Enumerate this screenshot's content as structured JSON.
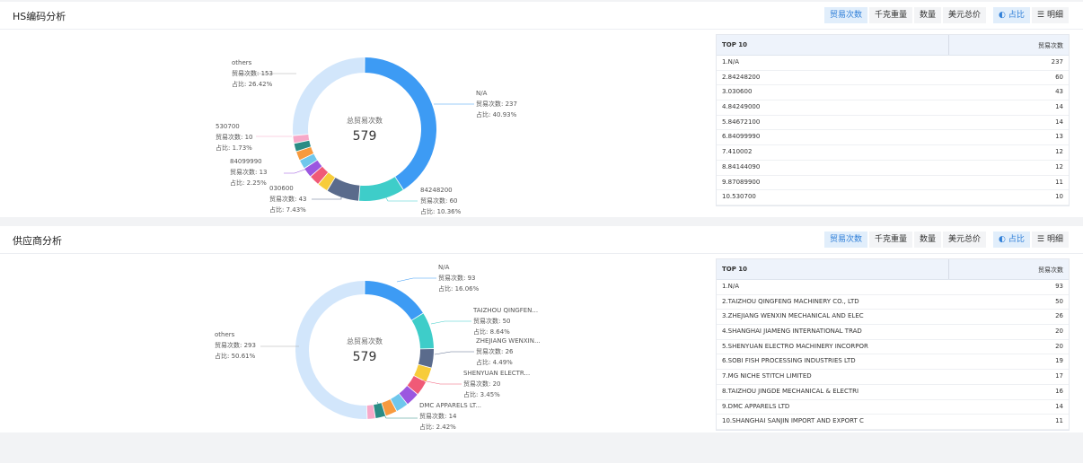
{
  "toolbar": {
    "buttons": [
      "贸易次数",
      "千克重量",
      "数量",
      "美元总价"
    ],
    "view_ratio": "占比",
    "view_detail": "明细"
  },
  "hs_panel": {
    "title": "HS编码分析",
    "center_label": "总贸易次数",
    "center_value": "579",
    "labels": {
      "others": {
        "name": "others",
        "count": "贸易次数: 153",
        "pct": "占比: 26.42%"
      },
      "na": {
        "name": "N/A",
        "count": "贸易次数: 237",
        "pct": "占比: 40.93%"
      },
      "s530700": {
        "name": "530700",
        "count": "贸易次数: 10",
        "pct": "占比: 1.73%"
      },
      "s84099990": {
        "name": "84099990",
        "count": "贸易次数: 13",
        "pct": "占比: 2.25%"
      },
      "s030600": {
        "name": "030600",
        "count": "贸易次数: 43",
        "pct": "占比: 7.43%"
      },
      "s84248200": {
        "name": "84248200",
        "count": "贸易次数: 60",
        "pct": "占比: 10.36%"
      }
    },
    "table": {
      "header_left": "TOP 10",
      "header_right": "贸易次数",
      "rows": [
        {
          "label": "1.N/A",
          "value": "237"
        },
        {
          "label": "2.84248200",
          "value": "60"
        },
        {
          "label": "3.030600",
          "value": "43"
        },
        {
          "label": "4.84249000",
          "value": "14"
        },
        {
          "label": "5.84672100",
          "value": "14"
        },
        {
          "label": "6.84099990",
          "value": "13"
        },
        {
          "label": "7.410002",
          "value": "12"
        },
        {
          "label": "8.84144090",
          "value": "12"
        },
        {
          "label": "9.87089900",
          "value": "11"
        },
        {
          "label": "10.530700",
          "value": "10"
        }
      ]
    }
  },
  "supplier_panel": {
    "title": "供应商分析",
    "center_label": "总贸易次数",
    "center_value": "579",
    "labels": {
      "na": {
        "name": "N/A",
        "count": "贸易次数: 93",
        "pct": "占比: 16.06%"
      },
      "taizhou": {
        "name": "TAIZHOU QINGFEN...",
        "count": "贸易次数: 50",
        "pct": "占比: 8.64%"
      },
      "zhejiang": {
        "name": "ZHEJIANG WENXIN...",
        "count": "贸易次数: 26",
        "pct": "占比: 4.49%"
      },
      "shenyuan": {
        "name": "SHENYUAN ELECTR...",
        "count": "贸易次数: 20",
        "pct": "占比: 3.45%"
      },
      "dmc": {
        "name": "DMC APPARELS LT...",
        "count": "贸易次数: 14",
        "pct": "占比: 2.42%"
      },
      "others": {
        "name": "others",
        "count": "贸易次数: 293",
        "pct": "占比: 50.61%"
      }
    },
    "table": {
      "header_left": "TOP 10",
      "header_right": "贸易次数",
      "rows": [
        {
          "label": "1.N/A",
          "value": "93"
        },
        {
          "label": "2.TAIZHOU QINGFENG MACHINERY CO., LTD",
          "value": "50"
        },
        {
          "label": "3.ZHEJIANG WENXIN MECHANICAL AND ELEC",
          "value": "26"
        },
        {
          "label": "4.SHANGHAI JIAMENG INTERNATIONAL TRAD",
          "value": "20"
        },
        {
          "label": "5.SHENYUAN ELECTRO MACHINERY INCORPOR",
          "value": "20"
        },
        {
          "label": "6.SOBI FISH PROCESSING INDUSTRIES LTD",
          "value": "19"
        },
        {
          "label": "7.MG NICHE STITCH LIMITED",
          "value": "17"
        },
        {
          "label": "8.TAIZHOU JINGDE MECHANICAL & ELECTRI",
          "value": "16"
        },
        {
          "label": "9.DMC APPARELS LTD",
          "value": "14"
        },
        {
          "label": "10.SHANGHAI SANJIN IMPORT AND EXPORT C",
          "value": "11"
        }
      ]
    }
  },
  "chart_data": [
    {
      "type": "pie",
      "center_value": 579,
      "slices": [
        {
          "name": "N/A",
          "value": 237,
          "color": "#3d9bf4"
        },
        {
          "name": "84248200",
          "value": 60,
          "color": "#3ecdc9"
        },
        {
          "name": "030600",
          "value": 43,
          "color": "#5a6b8c"
        },
        {
          "name": "84249000",
          "value": 14,
          "color": "#f7cc3a"
        },
        {
          "name": "84672100",
          "value": 14,
          "color": "#f05a77"
        },
        {
          "name": "84099990",
          "value": 13,
          "color": "#9b57e0"
        },
        {
          "name": "410002",
          "value": 12,
          "color": "#6fc7ec"
        },
        {
          "name": "84144090",
          "value": 12,
          "color": "#f79a3e"
        },
        {
          "name": "87089900",
          "value": 11,
          "color": "#2a8c85"
        },
        {
          "name": "530700",
          "value": 10,
          "color": "#f7a8c8"
        },
        {
          "name": "others",
          "value": 153,
          "color": "#d2e6fb"
        }
      ]
    },
    {
      "type": "pie",
      "center_value": 579,
      "slices": [
        {
          "name": "N/A",
          "value": 93,
          "color": "#3d9bf4"
        },
        {
          "name": "TAIZHOU QINGFENG MACHINERY CO., LTD",
          "value": 50,
          "color": "#3ecdc9"
        },
        {
          "name": "ZHEJIANG WENXIN MECHANICAL AND ELEC",
          "value": 26,
          "color": "#5a6b8c"
        },
        {
          "name": "SHANGHAI JIAMENG INTERNATIONAL TRAD",
          "value": 20,
          "color": "#f7cc3a"
        },
        {
          "name": "SHENYUAN ELECTRO MACHINERY INCORPOR",
          "value": 20,
          "color": "#f05a77"
        },
        {
          "name": "SOBI FISH PROCESSING INDUSTRIES LTD",
          "value": 19,
          "color": "#9b57e0"
        },
        {
          "name": "MG NICHE STITCH LIMITED",
          "value": 17,
          "color": "#6fc7ec"
        },
        {
          "name": "TAIZHOU JINGDE MECHANICAL & ELECTRI",
          "value": 16,
          "color": "#f79a3e"
        },
        {
          "name": "DMC APPARELS LTD",
          "value": 14,
          "color": "#2a8c85"
        },
        {
          "name": "SHANGHAI SANJIN IMPORT AND EXPORT C",
          "value": 11,
          "color": "#f7a8c8"
        },
        {
          "name": "others",
          "value": 293,
          "color": "#d2e6fb"
        }
      ]
    }
  ]
}
